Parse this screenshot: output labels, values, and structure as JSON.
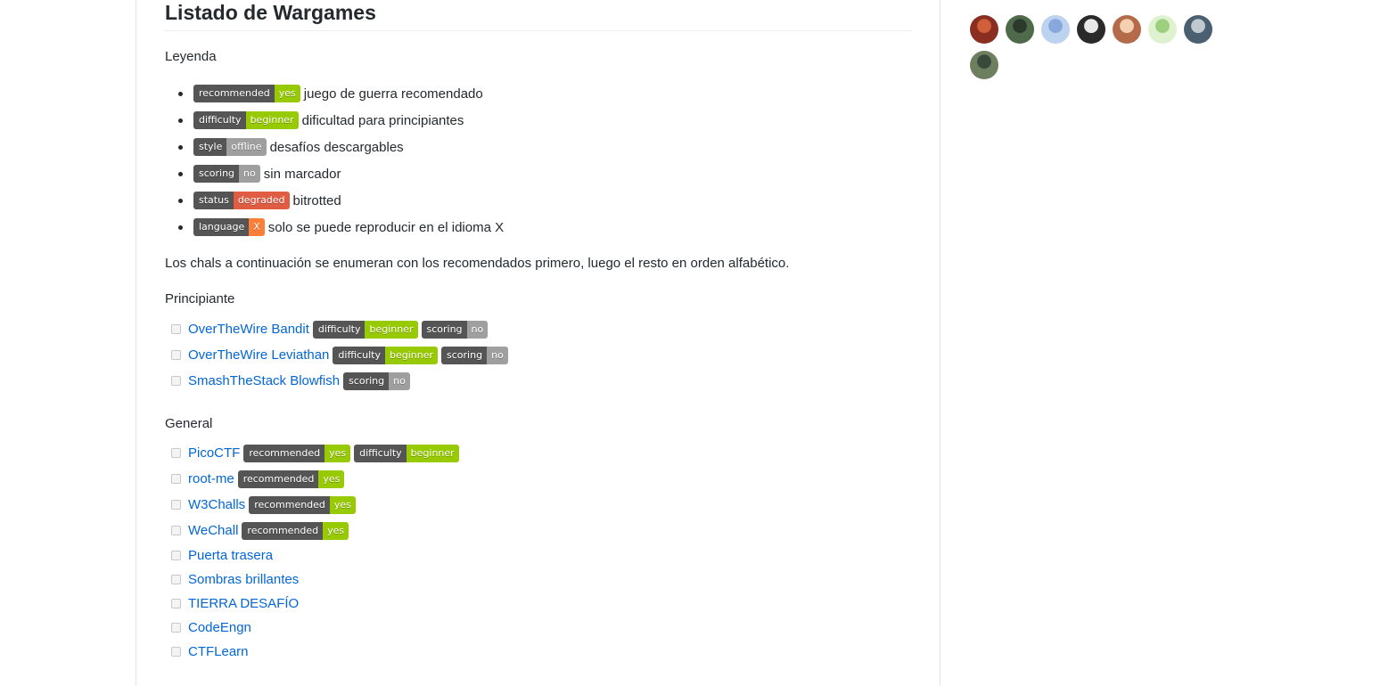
{
  "title": "Listado de Wargames",
  "legend_heading": "Leyenda",
  "legend": [
    {
      "badge": {
        "label": "recommended",
        "value": "yes",
        "color": "#97ca00"
      },
      "text": "juego de guerra recomendado"
    },
    {
      "badge": {
        "label": "difficulty",
        "value": "beginner",
        "color": "#97ca00"
      },
      "text": "dificultad para principiantes"
    },
    {
      "badge": {
        "label": "style",
        "value": "offline",
        "color": "#9f9f9f"
      },
      "text": "desafíos descargables"
    },
    {
      "badge": {
        "label": "scoring",
        "value": "no",
        "color": "#9f9f9f"
      },
      "text": "sin marcador"
    },
    {
      "badge": {
        "label": "status",
        "value": "degraded",
        "color": "#e05d44"
      },
      "text": "bitrotted"
    },
    {
      "badge": {
        "label": "language",
        "value": "X",
        "color": "#fe7d37"
      },
      "text": "solo se puede reproducir en el idioma X"
    }
  ],
  "description": "Los chals a continuación se enumeran con los recomendados primero, luego el resto en orden alfabético.",
  "sections": [
    {
      "heading": "Principiante",
      "items": [
        {
          "name": "OverTheWire Bandit",
          "badges": [
            {
              "label": "difficulty",
              "value": "beginner",
              "color": "#97ca00"
            },
            {
              "label": "scoring",
              "value": "no",
              "color": "#9f9f9f"
            }
          ]
        },
        {
          "name": "OverTheWire Leviathan",
          "badges": [
            {
              "label": "difficulty",
              "value": "beginner",
              "color": "#97ca00"
            },
            {
              "label": "scoring",
              "value": "no",
              "color": "#9f9f9f"
            }
          ]
        },
        {
          "name": "SmashTheStack Blowfish",
          "badges": [
            {
              "label": "scoring",
              "value": "no",
              "color": "#9f9f9f"
            }
          ]
        }
      ]
    },
    {
      "heading": "General",
      "items": [
        {
          "name": "PicoCTF",
          "badges": [
            {
              "label": "recommended",
              "value": "yes",
              "color": "#97ca00"
            },
            {
              "label": "difficulty",
              "value": "beginner",
              "color": "#97ca00"
            }
          ]
        },
        {
          "name": "root-me",
          "badges": [
            {
              "label": "recommended",
              "value": "yes",
              "color": "#97ca00"
            }
          ]
        },
        {
          "name": "W3Challs",
          "badges": [
            {
              "label": "recommended",
              "value": "yes",
              "color": "#97ca00"
            }
          ]
        },
        {
          "name": "WeChall",
          "badges": [
            {
              "label": "recommended",
              "value": "yes",
              "color": "#97ca00"
            }
          ]
        },
        {
          "name": "Puerta trasera",
          "badges": []
        },
        {
          "name": "Sombras brillantes",
          "badges": []
        },
        {
          "name": "TIERRA DESAFÍO",
          "badges": []
        },
        {
          "name": "CodeEngn",
          "badges": []
        },
        {
          "name": "CTFLearn",
          "badges": []
        }
      ]
    }
  ],
  "contributors": [
    {
      "color": "#8b2e22",
      "accent": "#d0603c"
    },
    {
      "color": "#4f6a4a",
      "accent": "#2c3a2c"
    },
    {
      "color": "#bcd2ee",
      "accent": "#88a8dd"
    },
    {
      "color": "#2a2a2a",
      "accent": "#e8e8e8"
    },
    {
      "color": "#b56a4a",
      "accent": "#f2d0b0"
    },
    {
      "color": "#dff2cf",
      "accent": "#9ccf7e"
    },
    {
      "color": "#4a6070",
      "accent": "#c0c8d0"
    },
    {
      "color": "#6e7f60",
      "accent": "#3a4a3a"
    }
  ]
}
